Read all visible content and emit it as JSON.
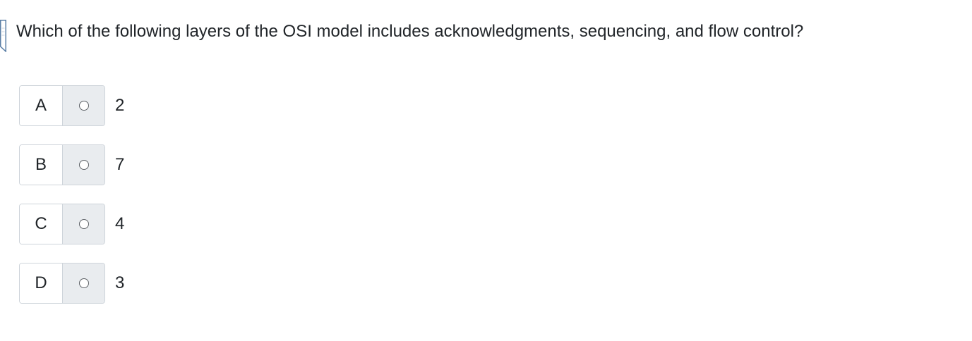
{
  "question": {
    "text": "Which of the following layers of the OSI model includes acknowledgments, sequencing, and flow control?"
  },
  "options": [
    {
      "letter": "A",
      "text": "2"
    },
    {
      "letter": "B",
      "text": "7"
    },
    {
      "letter": "C",
      "text": "4"
    },
    {
      "letter": "D",
      "text": "3"
    }
  ],
  "icons": {
    "bookmark": "bookmark-flag-icon",
    "radio": "radio-unchecked-icon"
  },
  "colors": {
    "text": "#212529",
    "border": "#ced4da",
    "radio_cell_bg": "#e9ecef",
    "flag_outline": "#5b7fa6"
  }
}
